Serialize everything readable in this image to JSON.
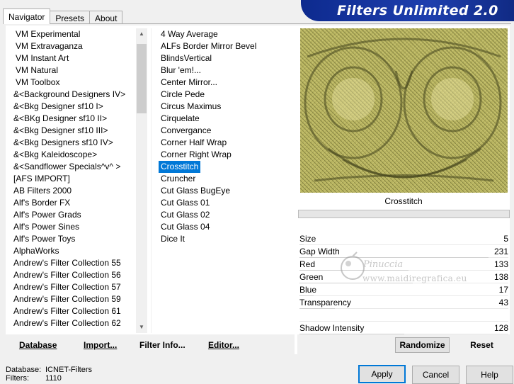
{
  "tabs": [
    {
      "label": "Navigator",
      "active": true
    },
    {
      "label": "Presets",
      "active": false
    },
    {
      "label": "About",
      "active": false
    }
  ],
  "banner": {
    "title": "Filters Unlimited 2.0",
    "color": "#1a3aa8"
  },
  "categories": [
    "VM Experimental",
    "VM Extravaganza",
    "VM Instant Art",
    "VM Natural",
    "VM Toolbox",
    "&<Background Designers IV>",
    "&<Bkg Designer sf10 I>",
    "&<BKg Designer sf10 II>",
    "&<Bkg Designer sf10 III>",
    "&<Bkg Designers sf10 IV>",
    "&<Bkg Kaleidoscope>",
    "&<Sandflower Specials^v^ >",
    "[AFS IMPORT]",
    "AB Filters 2000",
    "Alf's Border FX",
    "Alf's Power Grads",
    "Alf's Power Sines",
    "Alf's Power Toys",
    "AlphaWorks",
    "Andrew's Filter Collection 55",
    "Andrew's Filter Collection 56",
    "Andrew's Filter Collection 57",
    "Andrew's Filter Collection 59",
    "Andrew's Filter Collection 61",
    "Andrew's Filter Collection 62"
  ],
  "filters": [
    "4 Way Average",
    "ALFs Border Mirror Bevel",
    "BlindsVertical",
    "Blur 'em!...",
    "Center Mirror...",
    "Circle Pede",
    "Circus Maximus",
    "Cirquelate",
    "Convergance",
    "Corner Half Wrap",
    "Corner Right Wrap",
    "Crosstitch",
    "Cruncher",
    "Cut Glass  BugEye",
    "Cut Glass 01",
    "Cut Glass 02",
    "Cut Glass 04",
    "Dice It"
  ],
  "selected_filter_index": 11,
  "preview": {
    "label": "Crosstitch",
    "progress": 0
  },
  "params": [
    {
      "name": "Size",
      "value": "5",
      "max": 255
    },
    {
      "name": "Gap Width",
      "value": "231",
      "max": 255
    },
    {
      "name": "Red",
      "value": "133",
      "max": 255
    },
    {
      "name": "Green",
      "value": "138",
      "max": 255
    },
    {
      "name": "Blue",
      "value": "17",
      "max": 255
    },
    {
      "name": "Transparency",
      "value": "43",
      "max": 255
    },
    {
      "name": "",
      "value": "",
      "max": 255
    },
    {
      "name": "Shadow Intensity",
      "value": "128",
      "max": 255
    }
  ],
  "watermark": {
    "line1": "Pinuccia",
    "line2": "www.maidiregrafica.eu"
  },
  "buttons": {
    "database": "Database",
    "import": "Import...",
    "filter_info": "Filter Info...",
    "editor": "Editor...",
    "randomize": "Randomize",
    "reset": "Reset",
    "apply": "Apply",
    "cancel": "Cancel",
    "help": "Help"
  },
  "info": {
    "database_label": "Database:",
    "database_value": "ICNET-Filters",
    "filters_label": "Filters:",
    "filters_value": "1110"
  },
  "colors": {
    "selection": "#0078d7",
    "preview_base": "#b7b35f"
  }
}
